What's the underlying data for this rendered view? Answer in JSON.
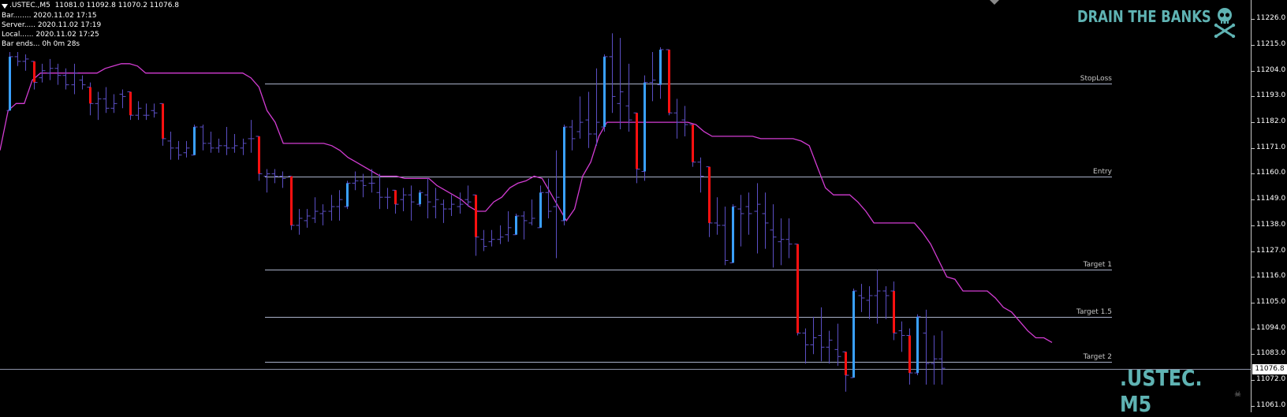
{
  "header": {
    "symbol_line": ".USTEC.,M5  11081.0 11092.8 11070.2 11076.8"
  },
  "info_panel": [
    "Bar........ 2020.11.02 17:15",
    "Server..... 2020.11.02 17:19",
    "Local...... 2020.11.02 17:25",
    "Bar ends... 0h 0m 28s"
  ],
  "brand": "DRAIN THE BANKS",
  "symbol_watermark": ".USTEC. M5",
  "current_price": "11076.8",
  "price_axis": {
    "ticks": [
      "11226.0",
      "11215.0",
      "11204.0",
      "11193.0",
      "11182.0",
      "11171.0",
      "11160.0",
      "11149.0",
      "11138.0",
      "11127.0",
      "11116.0",
      "11105.0",
      "11094.0",
      "11083.0",
      "11072.0",
      "11061.0"
    ]
  },
  "levels": [
    {
      "label": "StopLoss",
      "price": 11198.5
    },
    {
      "label": "Entry",
      "price": 11158.8
    },
    {
      "label": "Target 1",
      "price": 11119.0
    },
    {
      "label": "Target 1.5",
      "price": 11099.0
    },
    {
      "label": "Target 2",
      "price": 11079.6
    }
  ],
  "colors": {
    "background": "#000000",
    "bar_neutral": "#5b4fc4",
    "bar_bull": "#3aa0ff",
    "bar_bear": "#ff1010",
    "trail_line": "#d23cd2",
    "level_line": "#a9b1c9",
    "brand": "#5fb3b3"
  },
  "chart_data": {
    "type": "ohlc",
    "y_range": [
      11058.2,
      11234.2
    ],
    "bars": [
      {
        "o": 11187,
        "h": 11212,
        "l": 11187,
        "c": 11210,
        "d": "bull"
      },
      {
        "o": 11210,
        "h": 11212,
        "l": 11206,
        "c": 11208,
        "d": "n"
      },
      {
        "o": 11208,
        "h": 11211,
        "l": 11204,
        "c": 11209,
        "d": "n"
      },
      {
        "o": 11208,
        "h": 11208,
        "l": 11196,
        "c": 11199,
        "d": "bear"
      },
      {
        "o": 11201,
        "h": 11207,
        "l": 11199,
        "c": 11204,
        "d": "n"
      },
      {
        "o": 11203,
        "h": 11209,
        "l": 11200,
        "c": 11205,
        "d": "n"
      },
      {
        "o": 11205,
        "h": 11207,
        "l": 11198,
        "c": 11202,
        "d": "n"
      },
      {
        "o": 11202,
        "h": 11205,
        "l": 11196,
        "c": 11198,
        "d": "n"
      },
      {
        "o": 11198,
        "h": 11207,
        "l": 11194,
        "c": 11203,
        "d": "n"
      },
      {
        "o": 11200,
        "h": 11202,
        "l": 11196,
        "c": 11198,
        "d": "n"
      },
      {
        "o": 11197,
        "h": 11199,
        "l": 11185,
        "c": 11190,
        "d": "bear"
      },
      {
        "o": 11190,
        "h": 11195,
        "l": 11183,
        "c": 11192,
        "d": "n"
      },
      {
        "o": 11192,
        "h": 11197,
        "l": 11186,
        "c": 11188,
        "d": "n"
      },
      {
        "o": 11188,
        "h": 11194,
        "l": 11186,
        "c": 11190,
        "d": "n"
      },
      {
        "o": 11194,
        "h": 11196,
        "l": 11188,
        "c": 11193,
        "d": "n"
      },
      {
        "o": 11195,
        "h": 11195,
        "l": 11183,
        "c": 11185,
        "d": "bear"
      },
      {
        "o": 11185,
        "h": 11191,
        "l": 11183,
        "c": 11188,
        "d": "n"
      },
      {
        "o": 11185,
        "h": 11190,
        "l": 11183,
        "c": 11185,
        "d": "n"
      },
      {
        "o": 11187,
        "h": 11190,
        "l": 11184,
        "c": 11186,
        "d": "n"
      },
      {
        "o": 11190,
        "h": 11190,
        "l": 11172,
        "c": 11175,
        "d": "bear"
      },
      {
        "o": 11174,
        "h": 11178,
        "l": 11166,
        "c": 11171,
        "d": "n"
      },
      {
        "o": 11171,
        "h": 11174,
        "l": 11166,
        "c": 11168,
        "d": "n"
      },
      {
        "o": 11169,
        "h": 11174,
        "l": 11167,
        "c": 11171,
        "d": "n"
      },
      {
        "o": 11168,
        "h": 11181,
        "l": 11168,
        "c": 11180,
        "d": "bull"
      },
      {
        "o": 11180,
        "h": 11181,
        "l": 11170,
        "c": 11173,
        "d": "n"
      },
      {
        "o": 11173,
        "h": 11178,
        "l": 11169,
        "c": 11171,
        "d": "n"
      },
      {
        "o": 11171,
        "h": 11175,
        "l": 11169,
        "c": 11172,
        "d": "n"
      },
      {
        "o": 11172,
        "h": 11180,
        "l": 11168,
        "c": 11171,
        "d": "n"
      },
      {
        "o": 11171,
        "h": 11177,
        "l": 11169,
        "c": 11172,
        "d": "n"
      },
      {
        "o": 11171,
        "h": 11175,
        "l": 11168,
        "c": 11173,
        "d": "n"
      },
      {
        "o": 11175,
        "h": 11183,
        "l": 11169,
        "c": 11175,
        "d": "n"
      },
      {
        "o": 11176,
        "h": 11176,
        "l": 11157,
        "c": 11160,
        "d": "bear"
      },
      {
        "o": 11159,
        "h": 11162,
        "l": 11152,
        "c": 11160,
        "d": "n"
      },
      {
        "o": 11160,
        "h": 11162,
        "l": 11156,
        "c": 11159,
        "d": "n"
      },
      {
        "o": 11159,
        "h": 11161,
        "l": 11154,
        "c": 11158,
        "d": "n"
      },
      {
        "o": 11159,
        "h": 11159,
        "l": 11136,
        "c": 11138,
        "d": "bear"
      },
      {
        "o": 11138,
        "h": 11145,
        "l": 11134,
        "c": 11141,
        "d": "n"
      },
      {
        "o": 11140,
        "h": 11145,
        "l": 11137,
        "c": 11142,
        "d": "n"
      },
      {
        "o": 11141,
        "h": 11150,
        "l": 11139,
        "c": 11144,
        "d": "n"
      },
      {
        "o": 11143,
        "h": 11147,
        "l": 11138,
        "c": 11144,
        "d": "n"
      },
      {
        "o": 11144,
        "h": 11151,
        "l": 11140,
        "c": 11146,
        "d": "n"
      },
      {
        "o": 11146,
        "h": 11153,
        "l": 11140,
        "c": 11149,
        "d": "n"
      },
      {
        "o": 11146,
        "h": 11157,
        "l": 11145,
        "c": 11156,
        "d": "bull"
      },
      {
        "o": 11156,
        "h": 11161,
        "l": 11153,
        "c": 11157,
        "d": "n"
      },
      {
        "o": 11157,
        "h": 11160,
        "l": 11150,
        "c": 11155,
        "d": "n"
      },
      {
        "o": 11156,
        "h": 11162,
        "l": 11152,
        "c": 11156,
        "d": "n"
      },
      {
        "o": 11152,
        "h": 11160,
        "l": 11145,
        "c": 11150,
        "d": "n"
      },
      {
        "o": 11150,
        "h": 11154,
        "l": 11145,
        "c": 11150,
        "d": "n"
      },
      {
        "o": 11153,
        "h": 11153,
        "l": 11143,
        "c": 11147,
        "d": "bear"
      },
      {
        "o": 11149,
        "h": 11154,
        "l": 11144,
        "c": 11151,
        "d": "n"
      },
      {
        "o": 11151,
        "h": 11155,
        "l": 11140,
        "c": 11148,
        "d": "n"
      },
      {
        "o": 11147,
        "h": 11153,
        "l": 11146,
        "c": 11152,
        "d": "bull"
      },
      {
        "o": 11151,
        "h": 11158,
        "l": 11141,
        "c": 11148,
        "d": "n"
      },
      {
        "o": 11146,
        "h": 11154,
        "l": 11141,
        "c": 11149,
        "d": "n"
      },
      {
        "o": 11147,
        "h": 11149,
        "l": 11139,
        "c": 11145,
        "d": "n"
      },
      {
        "o": 11145,
        "h": 11151,
        "l": 11142,
        "c": 11147,
        "d": "n"
      },
      {
        "o": 11146,
        "h": 11152,
        "l": 11143,
        "c": 11147,
        "d": "n"
      },
      {
        "o": 11149,
        "h": 11155,
        "l": 11146,
        "c": 11148,
        "d": "n"
      },
      {
        "o": 11151,
        "h": 11151,
        "l": 11125,
        "c": 11133,
        "d": "bear"
      },
      {
        "o": 11132,
        "h": 11136,
        "l": 11127,
        "c": 11129,
        "d": "n"
      },
      {
        "o": 11131,
        "h": 11136,
        "l": 11129,
        "c": 11132,
        "d": "n"
      },
      {
        "o": 11132,
        "h": 11138,
        "l": 11130,
        "c": 11133,
        "d": "n"
      },
      {
        "o": 11134,
        "h": 11144,
        "l": 11131,
        "c": 11137,
        "d": "n"
      },
      {
        "o": 11134,
        "h": 11143,
        "l": 11134,
        "c": 11142,
        "d": "bull"
      },
      {
        "o": 11142,
        "h": 11144,
        "l": 11132,
        "c": 11140,
        "d": "n"
      },
      {
        "o": 11139,
        "h": 11149,
        "l": 11138,
        "c": 11141,
        "d": "n"
      },
      {
        "o": 11137,
        "h": 11155,
        "l": 11137,
        "c": 11152,
        "d": "bull"
      },
      {
        "o": 11152,
        "h": 11158,
        "l": 11141,
        "c": 11144,
        "d": "n"
      },
      {
        "o": 11146,
        "h": 11170,
        "l": 11124,
        "c": 11150,
        "d": "n"
      },
      {
        "o": 11140,
        "h": 11181,
        "l": 11138,
        "c": 11180,
        "d": "bull"
      },
      {
        "o": 11180,
        "h": 11183,
        "l": 11170,
        "c": 11175,
        "d": "n"
      },
      {
        "o": 11178,
        "h": 11193,
        "l": 11175,
        "c": 11182,
        "d": "n"
      },
      {
        "o": 11183,
        "h": 11195,
        "l": 11171,
        "c": 11177,
        "d": "n"
      },
      {
        "o": 11177,
        "h": 11205,
        "l": 11172,
        "c": 11182,
        "d": "n"
      },
      {
        "o": 11180,
        "h": 11211,
        "l": 11178,
        "c": 11210,
        "d": "bull"
      },
      {
        "o": 11210,
        "h": 11220,
        "l": 11186,
        "c": 11193,
        "d": "n"
      },
      {
        "o": 11190,
        "h": 11218,
        "l": 11179,
        "c": 11195,
        "d": "n"
      },
      {
        "o": 11189,
        "h": 11207,
        "l": 11178,
        "c": 11183,
        "d": "n"
      },
      {
        "o": 11186,
        "h": 11186,
        "l": 11156,
        "c": 11162,
        "d": "bear"
      },
      {
        "o": 11161,
        "h": 11202,
        "l": 11157,
        "c": 11199,
        "d": "bull"
      },
      {
        "o": 11199,
        "h": 11212,
        "l": 11191,
        "c": 11200,
        "d": "n"
      },
      {
        "o": 11198,
        "h": 11214,
        "l": 11192,
        "c": 11213,
        "d": "bull"
      },
      {
        "o": 11213,
        "h": 11213,
        "l": 11185,
        "c": 11186,
        "d": "bear"
      },
      {
        "o": 11186,
        "h": 11192,
        "l": 11175,
        "c": 11182,
        "d": "n"
      },
      {
        "o": 11183,
        "h": 11189,
        "l": 11176,
        "c": 11181,
        "d": "n"
      },
      {
        "o": 11181,
        "h": 11181,
        "l": 11163,
        "c": 11165,
        "d": "bear"
      },
      {
        "o": 11165,
        "h": 11167,
        "l": 11152,
        "c": 11159,
        "d": "n"
      },
      {
        "o": 11163,
        "h": 11163,
        "l": 11133,
        "c": 11139,
        "d": "bear"
      },
      {
        "o": 11139,
        "h": 11150,
        "l": 11134,
        "c": 11138,
        "d": "n"
      },
      {
        "o": 11138,
        "h": 11146,
        "l": 11121,
        "c": 11123,
        "d": "n"
      },
      {
        "o": 11122,
        "h": 11147,
        "l": 11122,
        "c": 11146,
        "d": "bull"
      },
      {
        "o": 11145,
        "h": 11151,
        "l": 11129,
        "c": 11143,
        "d": "n"
      },
      {
        "o": 11146,
        "h": 11152,
        "l": 11134,
        "c": 11143,
        "d": "n"
      },
      {
        "o": 11144,
        "h": 11156,
        "l": 11126,
        "c": 11147,
        "d": "n"
      },
      {
        "o": 11143,
        "h": 11152,
        "l": 11128,
        "c": 11139,
        "d": "n"
      },
      {
        "o": 11136,
        "h": 11147,
        "l": 11120,
        "c": 11133,
        "d": "n"
      },
      {
        "o": 11131,
        "h": 11141,
        "l": 11121,
        "c": 11132,
        "d": "n"
      },
      {
        "o": 11132,
        "h": 11141,
        "l": 11124,
        "c": 11130,
        "d": "n"
      },
      {
        "o": 11130,
        "h": 11130,
        "l": 11091,
        "c": 11092,
        "d": "bear"
      },
      {
        "o": 11092,
        "h": 11094,
        "l": 11079,
        "c": 11087,
        "d": "n"
      },
      {
        "o": 11087,
        "h": 11099,
        "l": 11083,
        "c": 11090,
        "d": "n"
      },
      {
        "o": 11091,
        "h": 11103,
        "l": 11080,
        "c": 11086,
        "d": "n"
      },
      {
        "o": 11086,
        "h": 11093,
        "l": 11079,
        "c": 11089,
        "d": "n"
      },
      {
        "o": 11085,
        "h": 11096,
        "l": 11078,
        "c": 11082,
        "d": "n"
      },
      {
        "o": 11084,
        "h": 11084,
        "l": 11067,
        "c": 11074,
        "d": "bear"
      },
      {
        "o": 11073,
        "h": 11111,
        "l": 11073,
        "c": 11110,
        "d": "bull"
      },
      {
        "o": 11108,
        "h": 11113,
        "l": 11101,
        "c": 11107,
        "d": "n"
      },
      {
        "o": 11106,
        "h": 11112,
        "l": 11098,
        "c": 11108,
        "d": "n"
      },
      {
        "o": 11108,
        "h": 11119,
        "l": 11096,
        "c": 11110,
        "d": "n"
      },
      {
        "o": 11110,
        "h": 11112,
        "l": 11098,
        "c": 11108,
        "d": "n"
      },
      {
        "o": 11110,
        "h": 11114,
        "l": 11089,
        "c": 11092,
        "d": "bear"
      },
      {
        "o": 11093,
        "h": 11097,
        "l": 11084,
        "c": 11091,
        "d": "n"
      },
      {
        "o": 11091,
        "h": 11094,
        "l": 11070,
        "c": 11075,
        "d": "bear"
      },
      {
        "o": 11075,
        "h": 11100,
        "l": 11074,
        "c": 11099,
        "d": "bull"
      },
      {
        "o": 11092,
        "h": 11102,
        "l": 11070,
        "c": 11079,
        "d": "n"
      },
      {
        "o": 11079,
        "h": 11091,
        "l": 11070,
        "c": 11081,
        "d": "n"
      },
      {
        "o": 11081,
        "h": 11093,
        "l": 11070,
        "c": 11077,
        "d": "n"
      }
    ],
    "trail_line": [
      11170,
      11187,
      11190,
      11190,
      11200,
      11203,
      11203,
      11203,
      11203,
      11203,
      11203,
      11203,
      11203,
      11205,
      11206,
      11207,
      11207,
      11206,
      11203,
      11203,
      11203,
      11203,
      11203,
      11203,
      11203,
      11203,
      11203,
      11203,
      11203,
      11203,
      11203,
      11201,
      11197,
      11187,
      11182,
      11173,
      11173,
      11173,
      11173,
      11173,
      11173,
      11172,
      11170,
      11167,
      11165,
      11163,
      11161,
      11159,
      11159,
      11159,
      11158,
      11158,
      11158,
      11158,
      11155,
      11153,
      11151,
      11149,
      11146,
      11144,
      11144,
      11148,
      11150,
      11154,
      11156,
      11157,
      11159,
      11158,
      11152,
      11146,
      11140,
      11145,
      11159,
      11165,
      11176,
      11182,
      11182,
      11182,
      11182,
      11182,
      11182,
      11182,
      11182,
      11182,
      11182,
      11182,
      11181,
      11178,
      11176,
      11176,
      11176,
      11176,
      11176,
      11176,
      11175,
      11175,
      11175,
      11175,
      11175,
      11174,
      11172,
      11163,
      11154,
      11151,
      11151,
      11151,
      11148,
      11144,
      11139,
      11139,
      11139,
      11139,
      11139,
      11139,
      11135,
      11130,
      11123,
      11116,
      11115,
      11110,
      11110,
      11110,
      11110,
      11107,
      11103,
      11101,
      11097,
      11093,
      11090,
      11090,
      11088
    ]
  }
}
